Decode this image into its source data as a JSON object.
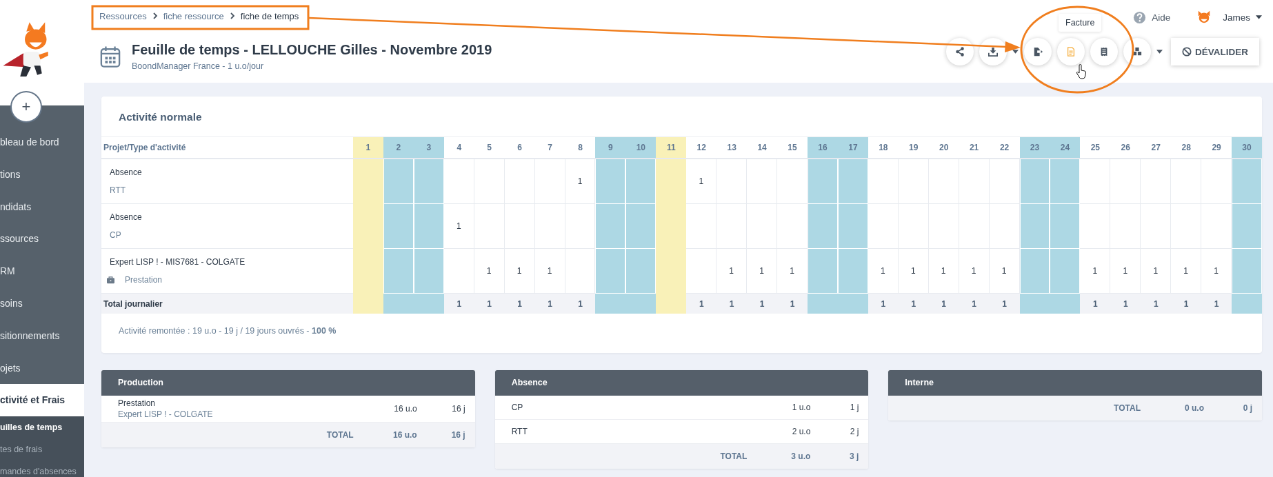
{
  "sidebar": {
    "add_button": "+",
    "items": [
      {
        "label": "bleau de bord",
        "selected": false
      },
      {
        "label": "tions",
        "selected": false
      },
      {
        "label": "ndidats",
        "selected": false
      },
      {
        "label": "ssources",
        "selected": false
      },
      {
        "label": "RM",
        "selected": false
      },
      {
        "label": "soins",
        "selected": false
      },
      {
        "label": "sitionnements",
        "selected": false
      },
      {
        "label": "ojets",
        "selected": false
      },
      {
        "label": "ctivité et Frais",
        "selected": true
      }
    ],
    "subitems": [
      {
        "label": "uilles de temps",
        "selected": true
      },
      {
        "label": "tes de frais",
        "selected": false
      },
      {
        "label": "mandes d'absences",
        "selected": false
      }
    ]
  },
  "breadcrumb": [
    {
      "label": "Ressources",
      "current": false
    },
    {
      "label": "fiche ressource",
      "current": false
    },
    {
      "label": "fiche de temps",
      "current": true
    }
  ],
  "header": {
    "title": "Feuille de temps - LELLOUCHE Gilles - Novembre 2019",
    "subtitle": "BoondManager France - 1 u.o/jour",
    "help": "Aide",
    "user": "James"
  },
  "toolbar": {
    "tooltip": "Facture",
    "validate_button": "DÉVALIDER",
    "buttons": [
      {
        "kind": "share",
        "hovered": false,
        "dropdown": false
      },
      {
        "kind": "download",
        "hovered": false,
        "dropdown": true
      },
      {
        "kind": "export",
        "hovered": false,
        "dropdown": false
      },
      {
        "kind": "invoice",
        "hovered": true,
        "dropdown": false
      },
      {
        "kind": "receipt",
        "hovered": false,
        "dropdown": false
      },
      {
        "kind": "cubes",
        "hovered": false,
        "dropdown": true
      }
    ]
  },
  "activity": {
    "title": "Activité normale",
    "column_header": "Projet/Type d'activité",
    "days": [
      {
        "label": "1",
        "kind": "holiday"
      },
      {
        "label": "2",
        "kind": "weekend"
      },
      {
        "label": "3",
        "kind": "weekend"
      },
      {
        "label": "4",
        "kind": "work"
      },
      {
        "label": "5",
        "kind": "work"
      },
      {
        "label": "6",
        "kind": "work"
      },
      {
        "label": "7",
        "kind": "work"
      },
      {
        "label": "8",
        "kind": "work"
      },
      {
        "label": "9",
        "kind": "weekend"
      },
      {
        "label": "10",
        "kind": "weekend"
      },
      {
        "label": "11",
        "kind": "holiday"
      },
      {
        "label": "12",
        "kind": "work"
      },
      {
        "label": "13",
        "kind": "work"
      },
      {
        "label": "14",
        "kind": "work"
      },
      {
        "label": "15",
        "kind": "work"
      },
      {
        "label": "16",
        "kind": "weekend"
      },
      {
        "label": "17",
        "kind": "weekend"
      },
      {
        "label": "18",
        "kind": "work"
      },
      {
        "label": "19",
        "kind": "work"
      },
      {
        "label": "20",
        "kind": "work"
      },
      {
        "label": "21",
        "kind": "work"
      },
      {
        "label": "22",
        "kind": "work"
      },
      {
        "label": "23",
        "kind": "weekend"
      },
      {
        "label": "24",
        "kind": "weekend"
      },
      {
        "label": "25",
        "kind": "work"
      },
      {
        "label": "26",
        "kind": "work"
      },
      {
        "label": "27",
        "kind": "work"
      },
      {
        "label": "28",
        "kind": "work"
      },
      {
        "label": "29",
        "kind": "work"
      },
      {
        "label": "30",
        "kind": "weekend"
      }
    ],
    "rows": [
      {
        "kind": "absence",
        "title": "Absence",
        "subtitle": "RTT",
        "cells": [
          {
            "kind": "empty"
          },
          {
            "kind": "empty"
          },
          {
            "kind": "empty"
          },
          {
            "kind": "empty"
          },
          {
            "kind": "empty"
          },
          {
            "kind": "empty"
          },
          {
            "kind": "empty"
          },
          {
            "kind": "entry",
            "value": "1"
          },
          {
            "kind": "empty"
          },
          {
            "kind": "empty"
          },
          {
            "kind": "empty"
          },
          {
            "kind": "entry",
            "value": "1"
          },
          {
            "kind": "empty"
          },
          {
            "kind": "empty"
          },
          {
            "kind": "empty"
          },
          {
            "kind": "empty"
          },
          {
            "kind": "empty"
          },
          {
            "kind": "empty"
          },
          {
            "kind": "empty"
          },
          {
            "kind": "empty"
          },
          {
            "kind": "empty"
          },
          {
            "kind": "empty"
          },
          {
            "kind": "empty"
          },
          {
            "kind": "empty"
          },
          {
            "kind": "empty"
          },
          {
            "kind": "empty"
          },
          {
            "kind": "empty"
          },
          {
            "kind": "empty"
          },
          {
            "kind": "empty"
          },
          {
            "kind": "empty"
          }
        ]
      },
      {
        "kind": "absence",
        "title": "Absence",
        "subtitle": "CP",
        "cells": [
          {
            "kind": "empty"
          },
          {
            "kind": "empty"
          },
          {
            "kind": "empty"
          },
          {
            "kind": "entry",
            "value": "1"
          },
          {
            "kind": "empty"
          },
          {
            "kind": "empty"
          },
          {
            "kind": "empty"
          },
          {
            "kind": "empty"
          },
          {
            "kind": "empty"
          },
          {
            "kind": "empty"
          },
          {
            "kind": "empty"
          },
          {
            "kind": "empty"
          },
          {
            "kind": "empty"
          },
          {
            "kind": "empty"
          },
          {
            "kind": "empty"
          },
          {
            "kind": "empty"
          },
          {
            "kind": "empty"
          },
          {
            "kind": "empty"
          },
          {
            "kind": "empty"
          },
          {
            "kind": "empty"
          },
          {
            "kind": "empty"
          },
          {
            "kind": "empty"
          },
          {
            "kind": "empty"
          },
          {
            "kind": "empty"
          },
          {
            "kind": "empty"
          },
          {
            "kind": "empty"
          },
          {
            "kind": "empty"
          },
          {
            "kind": "empty"
          },
          {
            "kind": "empty"
          },
          {
            "kind": "empty"
          }
        ]
      },
      {
        "kind": "production",
        "title": "Expert LISP ! - MIS7681 - COLGATE",
        "subtitle": "Prestation",
        "cells": [
          {
            "kind": "empty"
          },
          {
            "kind": "empty"
          },
          {
            "kind": "empty"
          },
          {
            "kind": "empty"
          },
          {
            "kind": "entry",
            "value": "1"
          },
          {
            "kind": "entry",
            "value": "1"
          },
          {
            "kind": "entry",
            "value": "1"
          },
          {
            "kind": "empty"
          },
          {
            "kind": "empty"
          },
          {
            "kind": "empty"
          },
          {
            "kind": "empty"
          },
          {
            "kind": "empty"
          },
          {
            "kind": "entry",
            "value": "1"
          },
          {
            "kind": "entry",
            "value": "1"
          },
          {
            "kind": "entry",
            "value": "1"
          },
          {
            "kind": "empty"
          },
          {
            "kind": "empty"
          },
          {
            "kind": "entry",
            "value": "1"
          },
          {
            "kind": "entry",
            "value": "1"
          },
          {
            "kind": "entry",
            "value": "1"
          },
          {
            "kind": "entry",
            "value": "1"
          },
          {
            "kind": "entry",
            "value": "1"
          },
          {
            "kind": "empty"
          },
          {
            "kind": "empty"
          },
          {
            "kind": "entry",
            "value": "1"
          },
          {
            "kind": "entry",
            "value": "1"
          },
          {
            "kind": "entry",
            "value": "1"
          },
          {
            "kind": "entry",
            "value": "1"
          },
          {
            "kind": "entry",
            "value": "1"
          },
          {
            "kind": "empty"
          }
        ]
      }
    ],
    "total": {
      "label": "Total journalier",
      "cells": [
        {
          "kind": "empty"
        },
        {
          "kind": "empty"
        },
        {
          "kind": "empty"
        },
        {
          "kind": "entry",
          "value": "1"
        },
        {
          "kind": "entry",
          "value": "1"
        },
        {
          "kind": "entry",
          "value": "1"
        },
        {
          "kind": "entry",
          "value": "1"
        },
        {
          "kind": "entry",
          "value": "1"
        },
        {
          "kind": "empty"
        },
        {
          "kind": "empty"
        },
        {
          "kind": "empty"
        },
        {
          "kind": "entry",
          "value": "1"
        },
        {
          "kind": "entry",
          "value": "1"
        },
        {
          "kind": "entry",
          "value": "1"
        },
        {
          "kind": "entry",
          "value": "1"
        },
        {
          "kind": "empty"
        },
        {
          "kind": "empty"
        },
        {
          "kind": "entry",
          "value": "1"
        },
        {
          "kind": "entry",
          "value": "1"
        },
        {
          "kind": "entry",
          "value": "1"
        },
        {
          "kind": "entry",
          "value": "1"
        },
        {
          "kind": "entry",
          "value": "1"
        },
        {
          "kind": "empty"
        },
        {
          "kind": "empty"
        },
        {
          "kind": "entry",
          "value": "1"
        },
        {
          "kind": "entry",
          "value": "1"
        },
        {
          "kind": "entry",
          "value": "1"
        },
        {
          "kind": "entry",
          "value": "1"
        },
        {
          "kind": "entry",
          "value": "1"
        },
        {
          "kind": "empty"
        }
      ]
    },
    "summary": "Activité remontée : 19 u.o - 19 j / 19 jours ouvrés - **100 %**"
  },
  "panels": [
    {
      "title": "Production",
      "rows": [
        {
          "label": "Prestation",
          "sublabel": "Expert LISP ! - COLGATE",
          "units": "16 u.o",
          "days": "16 j"
        }
      ],
      "total": {
        "label": "TOTAL",
        "units": "16 u.o",
        "days": "16 j"
      }
    },
    {
      "title": "Absence",
      "rows": [
        {
          "label": "CP",
          "units": "1 u.o",
          "days": "1 j"
        },
        {
          "label": "RTT",
          "units": "2 u.o",
          "days": "2 j"
        }
      ],
      "total": {
        "label": "TOTAL",
        "units": "3 u.o",
        "days": "3 j"
      }
    },
    {
      "title": "Interne",
      "total": {
        "label": "TOTAL",
        "units": "0 u.o",
        "days": "0 j"
      }
    }
  ]
}
